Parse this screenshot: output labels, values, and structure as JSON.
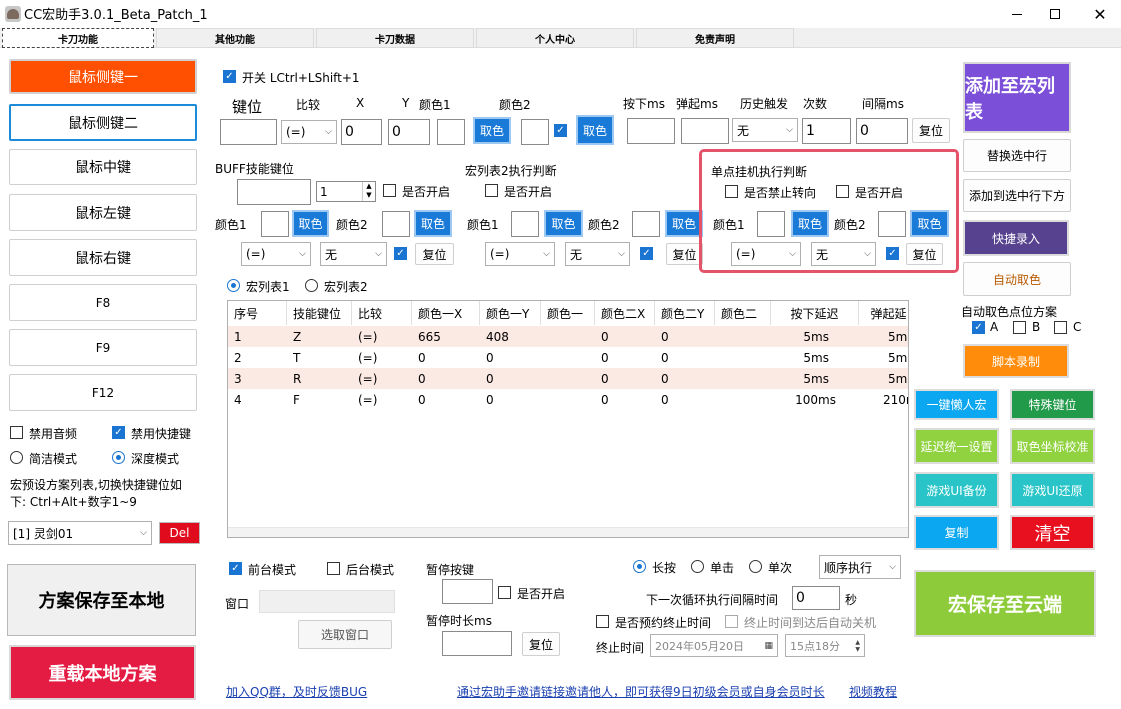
{
  "window": {
    "title": "CC宏助手3.0.1_Beta_Patch_1"
  },
  "tabs": [
    "卡刀功能",
    "其他功能",
    "卡刀数据",
    "个人中心",
    "免责声明"
  ],
  "left": {
    "buttons": [
      "鼠标侧键一",
      "鼠标侧键二",
      "鼠标中键",
      "鼠标左键",
      "鼠标右键",
      "F8",
      "F9",
      "F12"
    ],
    "mute_label": "禁用音频",
    "disable_hotkey_label": "禁用快捷键",
    "simple_mode_label": "简洁模式",
    "deep_mode_label": "深度模式",
    "hint": "宏预设方案列表,切换快捷键位如下: Ctrl+Alt+数字1~9",
    "preset_value": "[1] 灵剑01",
    "del_label": "Del",
    "save_local_label": "方案保存至本地",
    "reload_local_label": "重载本地方案"
  },
  "top": {
    "switch_label": "开关 LCtrl+LShift+1",
    "key_label": "键位",
    "compare_label": "比较",
    "x_label": "X",
    "y_label": "Y",
    "color1_label": "颜色1",
    "color2_label": "颜色2",
    "press_label": "按下ms",
    "bounce_label": "弹起ms",
    "history_label": "历史触发",
    "count_label": "次数",
    "interval_label": "间隔ms",
    "compare_value": "(=)",
    "x_value": "0",
    "y_value": "0",
    "pick_color_label": "取色",
    "history_value": "无",
    "count_value": "1",
    "interval_value": "0",
    "reset_label": "复位"
  },
  "buff": {
    "title": "BUFF技能键位",
    "spin_value": "1",
    "enable_label": "是否开启",
    "color1_label": "颜色1",
    "color2_label": "颜色2",
    "pick_label": "取色",
    "compare_value": "(=)",
    "history_value": "无",
    "reset_label": "复位"
  },
  "list2": {
    "title": "宏列表2执行判断",
    "enable_label": "是否开启",
    "color1_label": "颜色1",
    "color2_label": "颜色2",
    "pick_label": "取色",
    "compare_value": "(=)",
    "history_value": "无",
    "reset_label": "复位"
  },
  "single": {
    "title": "单点挂机执行判断",
    "no_turn_label": "是否禁止转向",
    "enable_label": "是否开启",
    "color1_label": "颜色1",
    "color2_label": "颜色2",
    "pick_label": "取色",
    "compare_value": "(=)",
    "history_value": "无",
    "reset_label": "复位"
  },
  "list_tabs": {
    "list1": "宏列表1",
    "list2": "宏列表2"
  },
  "table": {
    "headers": [
      "序号",
      "技能键位",
      "比较",
      "颜色一X",
      "颜色一Y",
      "颜色一",
      "颜色二X",
      "颜色二Y",
      "颜色二",
      "按下延迟",
      "弹起延"
    ],
    "rows": [
      {
        "no": "1",
        "key": "Z",
        "cmp": "(=)",
        "x1": "665",
        "y1": "408",
        "x2": "0",
        "y2": "0",
        "down": "5ms",
        "up": "5m"
      },
      {
        "no": "2",
        "key": "T",
        "cmp": "(=)",
        "x1": "0",
        "y1": "0",
        "x2": "0",
        "y2": "0",
        "down": "5ms",
        "up": "5m"
      },
      {
        "no": "3",
        "key": "R",
        "cmp": "(=)",
        "x1": "0",
        "y1": "0",
        "x2": "0",
        "y2": "0",
        "down": "5ms",
        "up": "5m"
      },
      {
        "no": "4",
        "key": "F",
        "cmp": "(=)",
        "x1": "0",
        "y1": "0",
        "x2": "0",
        "y2": "0",
        "down": "100ms",
        "up": "210r"
      }
    ]
  },
  "right": {
    "add_list_label": "添加至宏列表",
    "replace_label": "替换选中行",
    "add_below_label": "添加到选中行下方",
    "quick_record_label": "快捷录入",
    "auto_pick_label": "自动取色",
    "scheme_title": "自动取色点位方案",
    "scheme_a": "A",
    "scheme_b": "B",
    "scheme_c": "C",
    "script_record_label": "脚本录制",
    "lazy_macro_label": "一键懒人宏",
    "special_key_label": "特殊键位",
    "delay_unify_label": "延迟统一设置",
    "coord_calib_label": "取色坐标校准",
    "ui_backup_label": "游戏UI备份",
    "ui_restore_label": "游戏UI还原",
    "copy_label": "复制",
    "clear_label": "清空",
    "cloud_save_label": "宏保存至云端"
  },
  "bottom": {
    "foreground_label": "前台模式",
    "background_label": "后台模式",
    "window_label": "窗口",
    "select_window_label": "选取窗口",
    "pause_key_label": "暂停按键",
    "pause_enable_label": "是否开启",
    "pause_duration_label": "暂停时长ms",
    "reset_label": "复位",
    "long_press_label": "长按",
    "single_click_label": "单击",
    "single_time_label": "单次",
    "order_value": "顺序执行",
    "next_loop_label": "下一次循环执行间隔时间",
    "next_loop_value": "0",
    "seconds_label": "秒",
    "scheduled_end_label": "是否预约终止时间",
    "shutdown_label": "终止时间到达后自动关机",
    "end_time_label": "终止时间",
    "date_value": "2024年05月20日",
    "time_value": "15点18分",
    "qq_link": "加入QQ群，及时反馈BUG",
    "invite_link": "通过宏助手邀请链接邀请他人，即可获得9日初级会员或自身会员时长",
    "video_link": "视频教程"
  },
  "colors": {
    "accent": "#1a7ad8",
    "highlight_border": "#e4536a",
    "orange_red": "#fe5000",
    "purple": "#7b4fd8"
  }
}
